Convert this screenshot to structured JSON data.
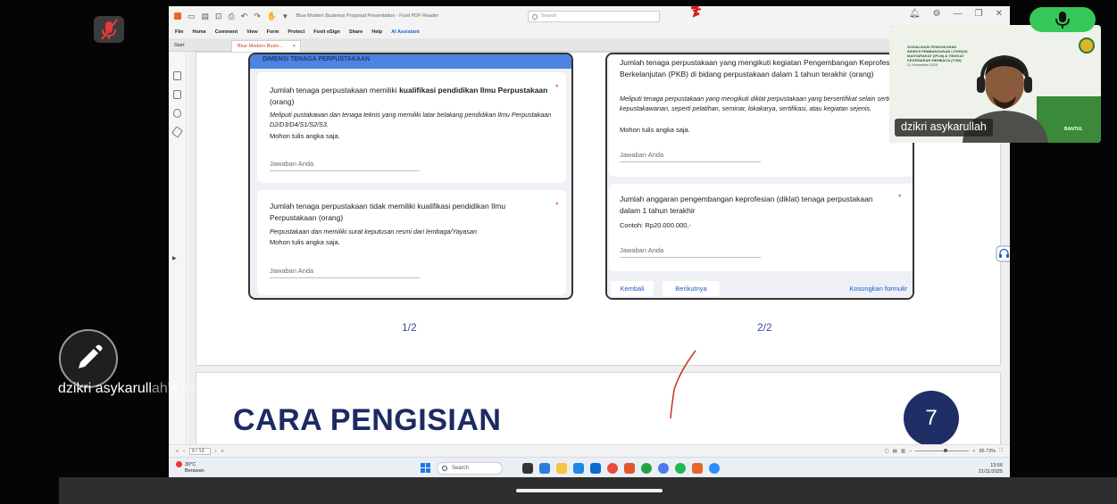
{
  "app": {
    "window_title": "Blue Modern Business Proposal Presentation - Foxit PDF Reader",
    "search_placeholder": "Search",
    "menu": [
      "File",
      "Home",
      "Comment",
      "View",
      "Form",
      "Protect",
      "Foxit eSign",
      "Share",
      "Help",
      "AI Assistant"
    ],
    "tabs": {
      "start": "Start",
      "doc": "Blue Modern Busin..."
    },
    "page_indicator": "9 / 13",
    "zoom": "95.73%"
  },
  "slide": {
    "form_left": {
      "header": "DIMENSI TENAGA PERPUSTAKAAN",
      "q1": {
        "pre": "Jumlah tenaga perpustakaan memiliki ",
        "bold": "kualifikasi pendidikan Ilmu Perpustakaan",
        "post": " (orang)",
        "desc": "Meliputi pustakawan dan tenaga teknis yang memiliki latar belakang pendidikan Ilmu Perpustakaan D2/D3/D4/S1/S2/S3.",
        "note": "Mohon tulis angka saja.",
        "answer": "Jawaban Anda"
      },
      "q2": {
        "text": "Jumlah tenaga perpustakaan tidak memiliki kualifikasi pendidikan Ilmu Perpustakaan (orang)",
        "desc": "Perpustakaan dan memiliki surat keputusan resmi dari lembaga/Yayasan",
        "note": "Mohon tulis angka saja.",
        "answer": "Jawaban Anda"
      },
      "page_label": "1/2"
    },
    "form_right": {
      "q1": {
        "text": "Jumlah tenaga perpustakaan yang mengikuti kegiatan Pengembangan Keprofesian Berkelanjutan (PKB) di bidang perpustakaan dalam 1 tahun terakhir (orang)",
        "desc": "Meliputi tenaga perpustakaan yang mengikuti diklat perpustakaan yang bersertifikat selain sertifikasi kepustakawanan, seperti pelatihan, seminar, lokakarya, sertifikasi, atau kegiatan sejenis.",
        "note": "Mohon tulis angka saja.",
        "answer": "Jawaban Anda"
      },
      "q2": {
        "text": "Jumlah anggaran pengembangan keprofesian (diklat) tenaga perpustakaan dalam 1 tahun terakhir",
        "note": "Contoh: Rp20.000.000,-",
        "answer": "Jawaban Anda"
      },
      "buttons": {
        "back": "Kembali",
        "next": "Berikutnya",
        "clear": "Kosongkan formulir"
      },
      "page_label": "2/2"
    },
    "next_slide_title": "CARA PENGISIAN",
    "badge": "7"
  },
  "taskbar": {
    "weather_temp": "30°C",
    "weather_desc": "Berawan",
    "search": "Search",
    "time": "13:56",
    "date": "21/11/2025"
  },
  "meeting": {
    "participant_name": "dzikri asykarullah",
    "screen_label_main": "dzikri asykarull",
    "screen_label_fade": "ah's screen",
    "cam_slide_text": "SOSIALISASI PENGUKURAN INDEKS PEMBANGUNAN LITERASI MASYARAKAT (IPLM) & TINGKAT KEGEMARAN MEMBACA (TGM)",
    "cam_slide_date": "21 November 2025",
    "cam_region": "BANTUL"
  }
}
